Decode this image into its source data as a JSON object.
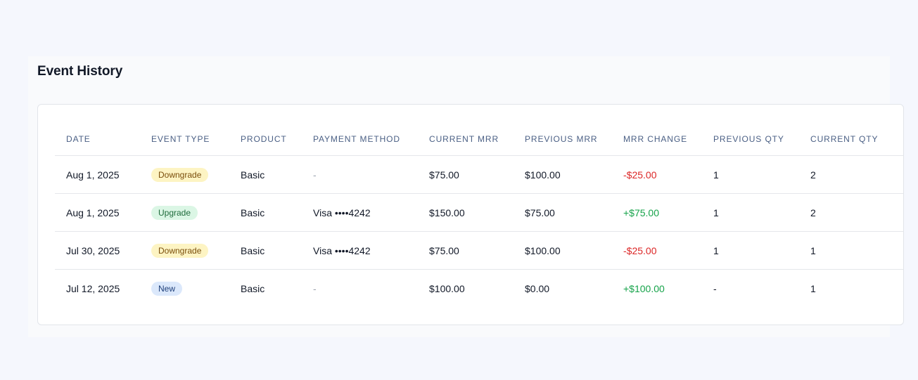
{
  "section": {
    "title": "Event History"
  },
  "table": {
    "columns": [
      "DATE",
      "EVENT TYPE",
      "PRODUCT",
      "PAYMENT METHOD",
      "CURRENT MRR",
      "PREVIOUS MRR",
      "MRR CHANGE",
      "PREVIOUS QTY",
      "CURRENT QTY"
    ],
    "rows": [
      {
        "date": "Aug 1, 2025",
        "event_type": "Downgrade",
        "event_kind": "downgrade",
        "product": "Basic",
        "payment_method": "-",
        "current_mrr": "$75.00",
        "previous_mrr": "$100.00",
        "mrr_change": "-$25.00",
        "change_direction": "negative",
        "previous_qty": "1",
        "current_qty": "2"
      },
      {
        "date": "Aug 1, 2025",
        "event_type": "Upgrade",
        "event_kind": "upgrade",
        "product": "Basic",
        "payment_method": "Visa ••••4242",
        "current_mrr": "$150.00",
        "previous_mrr": "$75.00",
        "mrr_change": "+$75.00",
        "change_direction": "positive",
        "previous_qty": "1",
        "current_qty": "2"
      },
      {
        "date": "Jul 30, 2025",
        "event_type": "Downgrade",
        "event_kind": "downgrade",
        "product": "Basic",
        "payment_method": "Visa ••••4242",
        "current_mrr": "$75.00",
        "previous_mrr": "$100.00",
        "mrr_change": "-$25.00",
        "change_direction": "negative",
        "previous_qty": "1",
        "current_qty": "1"
      },
      {
        "date": "Jul 12, 2025",
        "event_type": "New",
        "event_kind": "new",
        "product": "Basic",
        "payment_method": "-",
        "current_mrr": "$100.00",
        "previous_mrr": "$0.00",
        "mrr_change": "+$100.00",
        "change_direction": "positive",
        "previous_qty": "-",
        "current_qty": "1"
      }
    ]
  },
  "colors": {
    "page_background": "#f5f7fd",
    "negative": "#dc2626",
    "positive": "#16a34a",
    "header_text": "#4a5f84",
    "badge_downgrade": "#fdf4c3",
    "badge_upgrade": "#dbf6e5",
    "badge_new": "#dbe8fb"
  }
}
